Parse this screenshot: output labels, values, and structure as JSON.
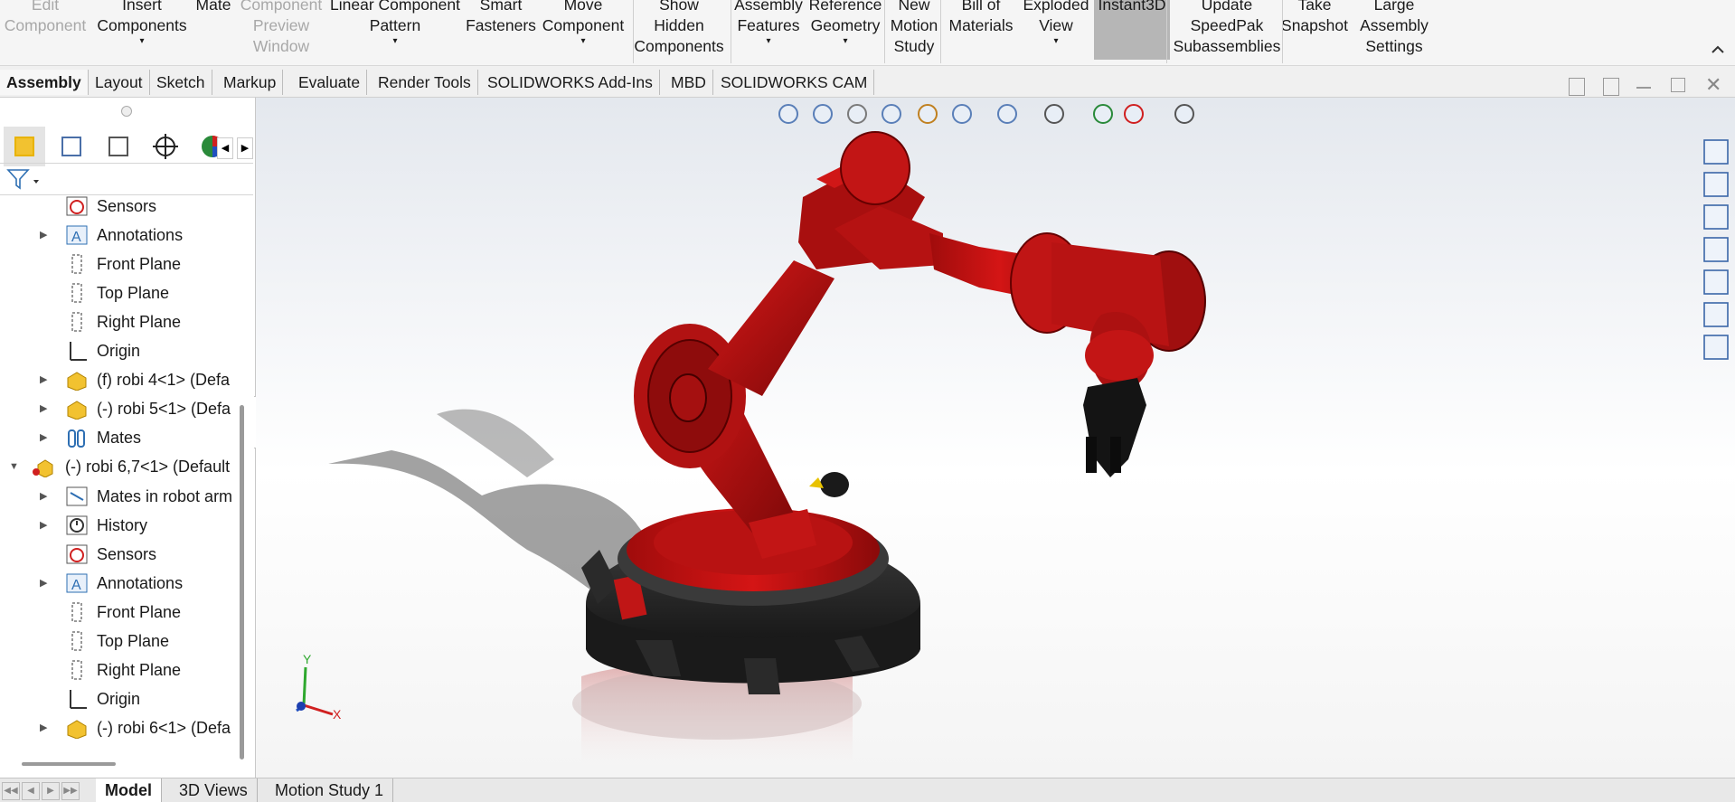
{
  "ribbon": {
    "buttons": [
      {
        "lines": [
          "Edit",
          "Component"
        ],
        "caret": false,
        "state": "disabled"
      },
      {
        "lines": [
          "Insert",
          "Components"
        ],
        "caret": true,
        "state": "normal"
      },
      {
        "lines": [
          "Mate"
        ],
        "caret": false,
        "state": "normal"
      },
      {
        "lines": [
          "Component",
          "Preview",
          "Window"
        ],
        "caret": false,
        "state": "disabled"
      },
      {
        "lines": [
          "Linear Component",
          "Pattern"
        ],
        "caret": true,
        "state": "normal"
      },
      {
        "lines": [
          "Smart",
          "Fasteners"
        ],
        "caret": false,
        "state": "normal"
      },
      {
        "lines": [
          "Move",
          "Component"
        ],
        "caret": true,
        "state": "normal"
      },
      {
        "lines": [
          "Show",
          "Hidden",
          "Components"
        ],
        "caret": false,
        "state": "normal"
      },
      {
        "lines": [
          "Assembly",
          "Features"
        ],
        "caret": true,
        "state": "normal"
      },
      {
        "lines": [
          "Reference",
          "Geometry"
        ],
        "caret": true,
        "state": "normal"
      },
      {
        "lines": [
          "New",
          "Motion",
          "Study"
        ],
        "caret": false,
        "state": "normal"
      },
      {
        "lines": [
          "Bill of",
          "Materials"
        ],
        "caret": false,
        "state": "normal"
      },
      {
        "lines": [
          "Exploded",
          "View"
        ],
        "caret": true,
        "state": "normal"
      },
      {
        "lines": [
          "Instant3D"
        ],
        "caret": false,
        "state": "active"
      },
      {
        "lines": [
          "Update",
          "SpeedPak",
          "Subassemblies"
        ],
        "caret": false,
        "state": "normal"
      },
      {
        "lines": [
          "Take",
          "Snapshot"
        ],
        "caret": false,
        "state": "normal"
      },
      {
        "lines": [
          "Large",
          "Assembly",
          "Settings"
        ],
        "caret": false,
        "state": "normal"
      }
    ],
    "collapse_icon": "chevron-up-icon"
  },
  "command_tabs": [
    "Assembly",
    "Layout",
    "Sketch",
    "Markup",
    "Evaluate",
    "Render Tools",
    "SOLIDWORKS Add-Ins",
    "MBD",
    "SOLIDWORKS CAM"
  ],
  "active_command_tab": "Assembly",
  "feature_tree": {
    "rows": [
      {
        "label": "Sensors",
        "icon": "sensors-icon",
        "expander": false,
        "indent": 1
      },
      {
        "label": "Annotations",
        "icon": "annotations-icon",
        "expander": true,
        "indent": 1
      },
      {
        "label": "Front Plane",
        "icon": "plane-icon",
        "expander": false,
        "indent": 1
      },
      {
        "label": "Top Plane",
        "icon": "plane-icon",
        "expander": false,
        "indent": 1
      },
      {
        "label": "Right Plane",
        "icon": "plane-icon",
        "expander": false,
        "indent": 1
      },
      {
        "label": "Origin",
        "icon": "origin-icon",
        "expander": false,
        "indent": 1
      },
      {
        "label": "(f) robi 4<1> (Defa",
        "icon": "part-icon",
        "expander": true,
        "indent": 1
      },
      {
        "label": "(-) robi 5<1> (Defa",
        "icon": "part-icon",
        "expander": true,
        "indent": 1
      },
      {
        "label": "Mates",
        "icon": "mates-icon",
        "expander": true,
        "indent": 1
      },
      {
        "label": "(-) robi 6,7<1> (Default",
        "icon": "subassembly-icon",
        "expander": true,
        "expanded": true,
        "indent": 0
      },
      {
        "label": "Mates in robot arm",
        "icon": "mates-folder-icon",
        "expander": true,
        "indent": 1
      },
      {
        "label": "History",
        "icon": "history-icon",
        "expander": true,
        "indent": 1
      },
      {
        "label": "Sensors",
        "icon": "sensors-icon",
        "expander": false,
        "indent": 1
      },
      {
        "label": "Annotations",
        "icon": "annotations-icon",
        "expander": true,
        "indent": 1
      },
      {
        "label": "Front Plane",
        "icon": "plane-icon",
        "expander": false,
        "indent": 1
      },
      {
        "label": "Top Plane",
        "icon": "plane-icon",
        "expander": false,
        "indent": 1
      },
      {
        "label": "Right Plane",
        "icon": "plane-icon",
        "expander": false,
        "indent": 1
      },
      {
        "label": "Origin",
        "icon": "origin-icon",
        "expander": false,
        "indent": 1
      },
      {
        "label": "(-) robi 6<1> (Defa",
        "icon": "part-icon",
        "expander": true,
        "indent": 1
      }
    ]
  },
  "panel_tabs": [
    "feature-manager-icon",
    "property-manager-icon",
    "configuration-manager-icon",
    "dimxpert-icon",
    "display-manager-icon"
  ],
  "view_toolbar": [
    "zoom-to-fit-icon",
    "zoom-to-area-icon",
    "previous-view-icon",
    "section-view-icon",
    "dynamic-annotation-icon",
    "view-orientation-icon",
    "display-style-icon",
    "hide-show-icon",
    "edit-appearance-icon",
    "apply-scene-icon",
    "view-settings-icon"
  ],
  "task_pane": [
    "solidworks-resources-icon",
    "home-icon",
    "design-library-icon",
    "file-explorer-icon",
    "view-palette-icon",
    "appearances-icon",
    "custom-properties-icon"
  ],
  "triad": {
    "x": "X",
    "y": "Y"
  },
  "bottom_tabs": [
    "Model",
    "3D Views",
    "Motion Study 1"
  ],
  "active_bottom_tab": "Model",
  "colors": {
    "robot_red": "#b01010",
    "base_black": "#1c1c1c",
    "active_ribbon": "#b6b6b6"
  }
}
